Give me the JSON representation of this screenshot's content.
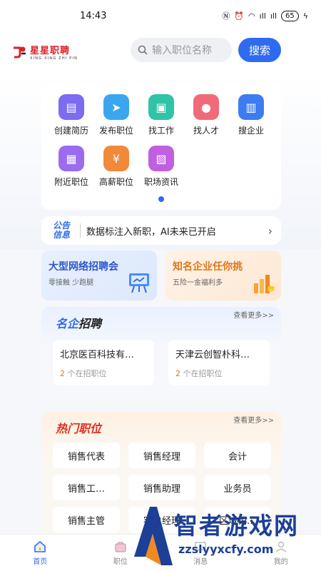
{
  "status_bar": {
    "time": "14:43",
    "icons": "N ⏰ 📶 5G ull 5G ull",
    "battery": "65"
  },
  "header": {
    "logo_cn": "星星职聘",
    "logo_en": "XING XING ZHI PIN",
    "search_placeholder": "输入职位名称",
    "search_button": "搜索"
  },
  "quick_actions": [
    {
      "label": "创建简历",
      "icon": "resume-icon",
      "color": "#7b6cf0"
    },
    {
      "label": "发布职位",
      "icon": "send-icon",
      "color": "#3aa6f0"
    },
    {
      "label": "找工作",
      "icon": "briefcase-icon",
      "color": "#2fc4a8"
    },
    {
      "label": "找人才",
      "icon": "person-icon",
      "color": "#f06a7a"
    },
    {
      "label": "搜企业",
      "icon": "enterprise-icon",
      "color": "#3d7cf0"
    },
    {
      "label": "附近职位",
      "icon": "building-icon",
      "color": "#9b6cf0"
    },
    {
      "label": "高薪职位",
      "icon": "money-bag-icon",
      "color": "#f08a3a"
    },
    {
      "label": "职场资讯",
      "icon": "news-icon",
      "color": "#c060e0"
    }
  ],
  "notice": {
    "tag_line1": "公告",
    "tag_line2": "信息",
    "text": "数据标注入新职，AI未来已开启"
  },
  "banners": [
    {
      "title": "大型网络招聘会",
      "subtitle": "零接触 少跑腿"
    },
    {
      "title": "知名企业任你挑",
      "subtitle": "五险一金福利多"
    }
  ],
  "famous": {
    "title_a": "名企",
    "title_b": "招聘",
    "more": "查看更多>>",
    "companies": [
      {
        "name": "北京医百科技有…",
        "count": "2",
        "suffix": "个在招职位"
      },
      {
        "name": "天津云创智朴科…",
        "count": "2",
        "suffix": "个在招职位"
      }
    ]
  },
  "hot": {
    "title": "热门职位",
    "more": "查看更多>>",
    "jobs": [
      "销售代表",
      "销售经理",
      "会计",
      "销售工…",
      "销售助理",
      "业务员",
      "销售主管",
      "客户经理",
      "区域销…"
    ]
  },
  "tabs": [
    {
      "label": "首页"
    },
    {
      "label": "职位"
    },
    {
      "label": "消息"
    },
    {
      "label": "我的"
    }
  ],
  "watermark": {
    "text": "智者游戏网",
    "url": "zzslyyxcfy.com"
  },
  "colors": {
    "primary": "#2f6bf0",
    "brand_red": "#d8232a",
    "accent_orange": "#e0771a"
  }
}
